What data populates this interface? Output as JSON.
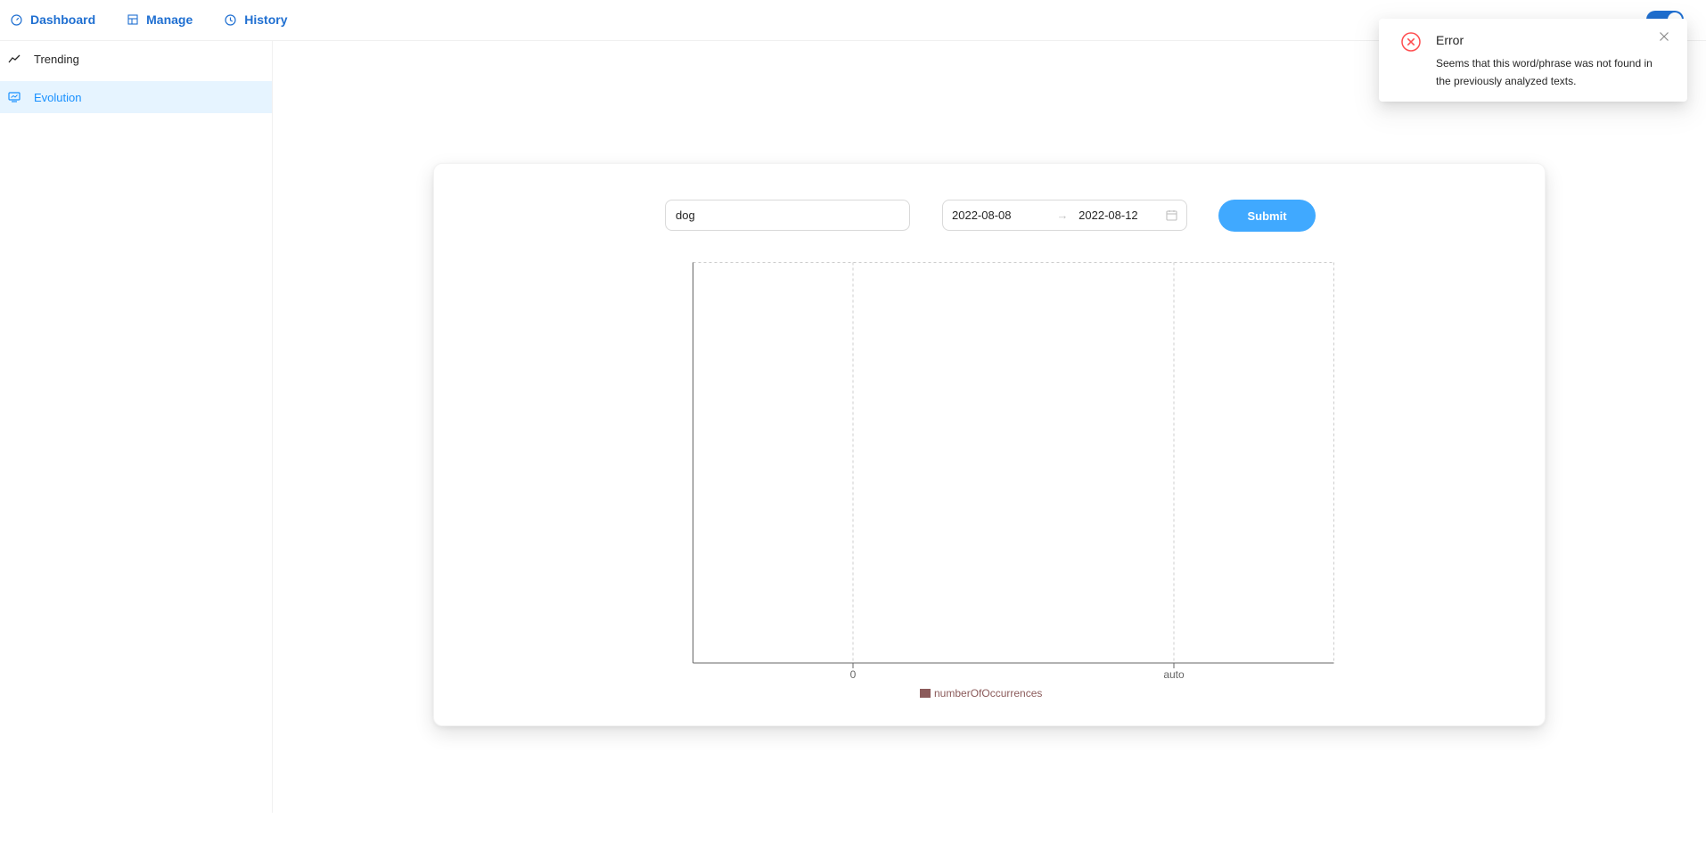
{
  "nav": {
    "items": [
      {
        "label": "Dashboard",
        "icon": "dashboard-icon"
      },
      {
        "label": "Manage",
        "icon": "manage-icon"
      },
      {
        "label": "History",
        "icon": "clock-icon"
      }
    ],
    "right_label": "",
    "toggle_on": true
  },
  "sidebar": {
    "items": [
      {
        "label": "Trending",
        "icon": "trend-line-icon",
        "active": false
      },
      {
        "label": "Evolution",
        "icon": "monitor-icon",
        "active": true
      }
    ]
  },
  "form": {
    "word_value": "dog",
    "start_date": "2022-08-08",
    "end_date": "2022-08-12",
    "submit_label": "Submit"
  },
  "chart_data": {
    "type": "line",
    "x_ticks": [
      "0",
      "auto"
    ],
    "series": [
      {
        "name": "numberOfOccurrences",
        "color": "#8b5a5a",
        "values": []
      }
    ],
    "grid": true
  },
  "notification": {
    "type": "error",
    "title": "Error",
    "message": "Seems that this word/phrase was not found in the previously analyzed texts.",
    "accent_color": "#ff4d4f"
  },
  "colors": {
    "primary": "#1f6fd1",
    "button": "#40a9ff",
    "active_bg": "#e6f4ff"
  }
}
